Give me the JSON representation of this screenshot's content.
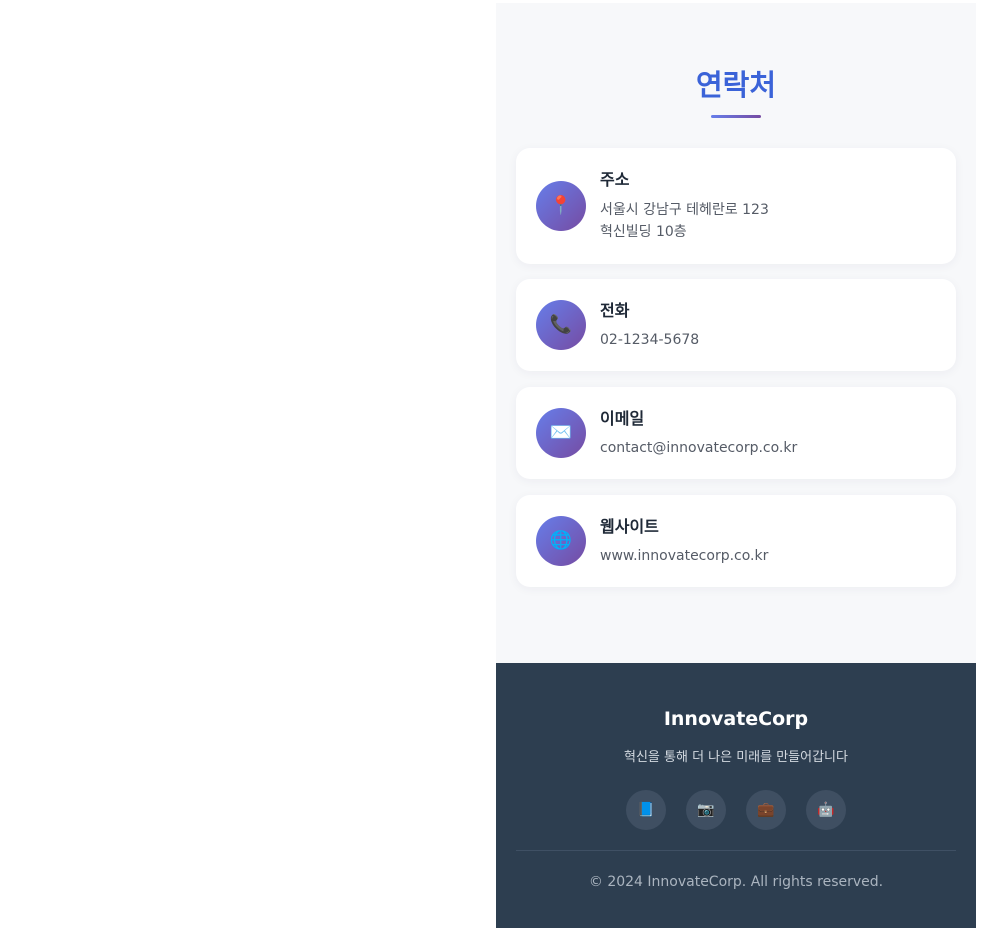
{
  "contact": {
    "title": "연락처",
    "items": [
      {
        "icon": "map-pin-icon",
        "glyph": "📍",
        "label": "주소",
        "lines": [
          "서울시 강남구 테헤란로 123",
          "혁신빌딩 10층"
        ]
      },
      {
        "icon": "phone-icon",
        "glyph": "📞",
        "label": "전화",
        "lines": [
          "02-1234-5678"
        ]
      },
      {
        "icon": "envelope-icon",
        "glyph": "✉️",
        "label": "이메일",
        "lines": [
          "contact@innovatecorp.co.kr"
        ]
      },
      {
        "icon": "globe-icon",
        "glyph": "🌐",
        "label": "웹사이트",
        "lines": [
          "www.innovatecorp.co.kr"
        ]
      }
    ]
  },
  "footer": {
    "brand": "InnovateCorp",
    "tagline": "혁신을 통해 더 나은 미래를 만들어갑니다",
    "social": [
      {
        "icon": "book-icon",
        "glyph": "📘"
      },
      {
        "icon": "camera-icon",
        "glyph": "📷"
      },
      {
        "icon": "briefcase-icon",
        "glyph": "💼"
      },
      {
        "icon": "robot-icon",
        "glyph": "🤖"
      }
    ],
    "copyright": "© 2024 InnovateCorp. All rights reserved."
  },
  "colors": {
    "accent": "#3b63d8",
    "gradient_start": "#667eea",
    "gradient_end": "#764ba2",
    "footer_bg": "#2d3e50",
    "section_bg": "#f7f8fa"
  }
}
